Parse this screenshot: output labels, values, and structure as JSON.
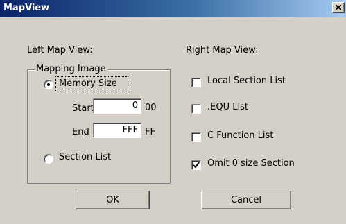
{
  "window": {
    "title": "MapView",
    "close_glyph": "X"
  },
  "left": {
    "heading": "Left Map View:",
    "group_label": "Mapping Image",
    "memory_size": {
      "label": "Memory Size",
      "selected": true
    },
    "start": {
      "label": "Start",
      "value": "0",
      "suffix": "00"
    },
    "end": {
      "label": "End",
      "value": "FFF",
      "suffix": "FF"
    },
    "section_list": {
      "label": "Section List",
      "selected": false
    }
  },
  "right": {
    "heading": "Right Map View:",
    "options": [
      {
        "label": "Local Section List",
        "checked": false
      },
      {
        "label": ".EQU List",
        "checked": false
      },
      {
        "label": "C Function List",
        "checked": false
      },
      {
        "label": "Omit 0 size Section",
        "checked": true
      }
    ]
  },
  "buttons": {
    "ok": "OK",
    "cancel": "Cancel"
  },
  "colors": {
    "face": "#d4d0c8",
    "title_start": "#0a246a",
    "title_end": "#a6caf0"
  }
}
